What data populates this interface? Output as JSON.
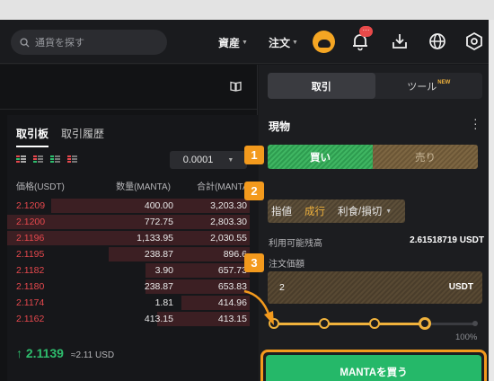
{
  "header": {
    "search_placeholder": "通貨を探す",
    "assets_label": "資産",
    "orders_label": "注文",
    "notification_badge": "···"
  },
  "orderbook": {
    "tabs": [
      "取引板",
      "取引履歴"
    ],
    "precision": "0.0001",
    "columns": {
      "price": "価格(USDT)",
      "qty": "数量(MANTA)",
      "total": "合計(MANTA)"
    },
    "asks": [
      {
        "price": "2.1209",
        "qty": "400.00",
        "total": "3,203.30",
        "depth": 0.82
      },
      {
        "price": "2.1200",
        "qty": "772.75",
        "total": "2,803.30",
        "depth": 1.0
      },
      {
        "price": "2.1196",
        "qty": "1,133.95",
        "total": "2,030.55",
        "depth": 1.0
      },
      {
        "price": "2.1195",
        "qty": "238.87",
        "total": "896.6",
        "depth": 0.58
      },
      {
        "price": "2.1182",
        "qty": "3.90",
        "total": "657.73",
        "depth": 0.43
      },
      {
        "price": "2.1180",
        "qty": "238.87",
        "total": "653.83",
        "depth": 0.43
      },
      {
        "price": "2.1174",
        "qty": "1.81",
        "total": "414.96",
        "depth": 0.28
      },
      {
        "price": "2.1162",
        "qty": "413.15",
        "total": "413.15",
        "depth": 0.38
      }
    ],
    "last_price": "2.1139",
    "last_price_usd": "≈2.11 USD"
  },
  "trade": {
    "tabs": [
      "取引",
      "ツール"
    ],
    "new_badge": "NEW",
    "section_title": "現物",
    "buy_label": "買い",
    "sell_label": "売り",
    "order_types": {
      "limit": "指値",
      "market": "成行",
      "tpsl": "利食/損切"
    },
    "available_label": "利用可能残高",
    "available_value": "2.61518719 USDT",
    "price_label": "注文価額",
    "amount_value": "2",
    "amount_unit": "USDT",
    "slider_percent": 0.75,
    "slider_max_label": "100%",
    "submit_label": "MANTAを買う"
  },
  "markers": [
    "1",
    "2",
    "3"
  ],
  "colors": {
    "accent": "#f39a1d",
    "buy": "#25b869",
    "ask": "#e5484d",
    "bid": "#2ebd6d"
  }
}
